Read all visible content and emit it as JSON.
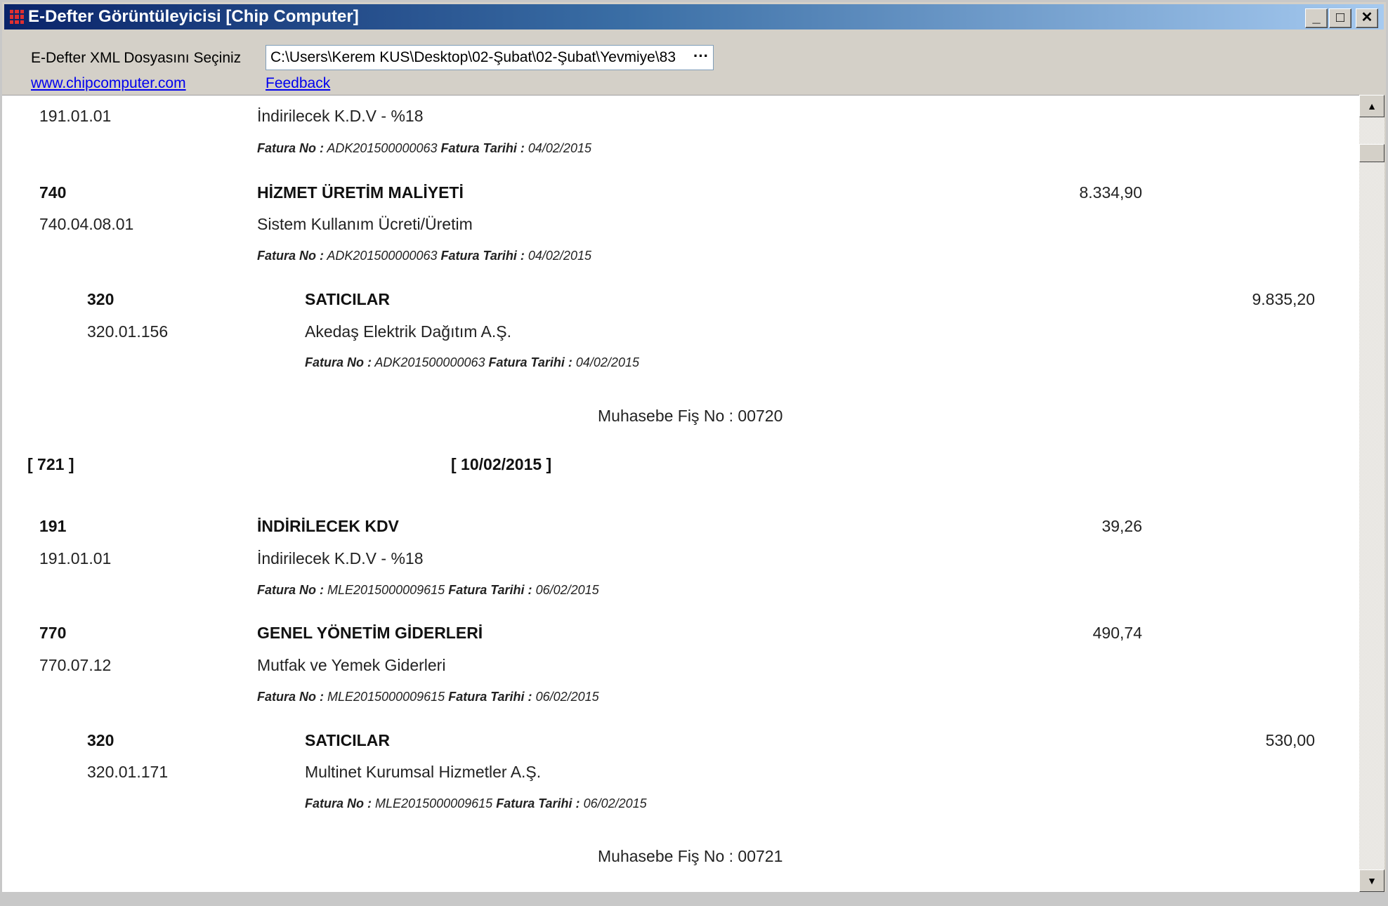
{
  "window": {
    "title": "E-Defter Görüntüleyicisi [Chip Computer]",
    "min_label": "_",
    "max_label": "□",
    "close_label": "✕"
  },
  "toolbar": {
    "file_label": "E-Defter XML Dosyasını Seçiniz",
    "file_path": "C:\\Users\\Kerem KUS\\Desktop\\02-Şubat\\02-Şubat\\Yevmiye\\83",
    "browse_label": "···",
    "site_link": "www.chipcomputer.com",
    "feedback_link": "Feedback"
  },
  "scrollbar": {
    "up_icon": "▲",
    "down_icon": "▼"
  },
  "entries": {
    "e1": {
      "code": "191.01.01",
      "name": "İndirilecek K.D.V - %18",
      "fatura_no_label": "Fatura No :",
      "fatura_no": "ADK201500000063",
      "fatura_tarihi_label": "Fatura Tarihi :",
      "fatura_tarihi": "04/02/2015"
    },
    "e2": {
      "code": "740",
      "name": "HİZMET ÜRETİM MALİYETİ",
      "amount": "8.334,90"
    },
    "e3": {
      "code": "740.04.08.01",
      "name": "Sistem Kullanım Ücreti/Üretim",
      "fatura_no_label": "Fatura No :",
      "fatura_no": "ADK201500000063",
      "fatura_tarihi_label": "Fatura Tarihi :",
      "fatura_tarihi": "04/02/2015"
    },
    "e4": {
      "code": "320",
      "name": "SATICILAR",
      "amount": "9.835,20"
    },
    "e5": {
      "code": "320.01.156",
      "name": "Akedaş Elektrik Dağıtım A.Ş.",
      "fatura_no_label": "Fatura No :",
      "fatura_no": "ADK201500000063",
      "fatura_tarihi_label": "Fatura Tarihi :",
      "fatura_tarihi": "04/02/2015"
    },
    "fis1": "Muhasebe Fiş No : 00720",
    "voucher_no": "[ 721 ]",
    "voucher_date": "[ 10/02/2015 ]",
    "e6": {
      "code": "191",
      "name": "İNDİRİLECEK KDV",
      "amount": "39,26"
    },
    "e7": {
      "code": "191.01.01",
      "name": "İndirilecek K.D.V - %18",
      "fatura_no_label": "Fatura No :",
      "fatura_no": "MLE2015000009615",
      "fatura_tarihi_label": "Fatura Tarihi :",
      "fatura_tarihi": "06/02/2015"
    },
    "e8": {
      "code": "770",
      "name": "GENEL YÖNETİM GİDERLERİ",
      "amount": "490,74"
    },
    "e9": {
      "code": "770.07.12",
      "name": "Mutfak ve Yemek Giderleri",
      "fatura_no_label": "Fatura No :",
      "fatura_no": "MLE2015000009615",
      "fatura_tarihi_label": "Fatura Tarihi :",
      "fatura_tarihi": "06/02/2015"
    },
    "e10": {
      "code": "320",
      "name": "SATICILAR",
      "amount": "530,00"
    },
    "e11": {
      "code": "320.01.171",
      "name": "Multinet Kurumsal Hizmetler A.Ş.",
      "fatura_no_label": "Fatura No :",
      "fatura_no": "MLE2015000009615",
      "fatura_tarihi_label": "Fatura Tarihi :",
      "fatura_tarihi": "06/02/2015"
    },
    "fis2": "Muhasebe Fiş No : 00721"
  }
}
